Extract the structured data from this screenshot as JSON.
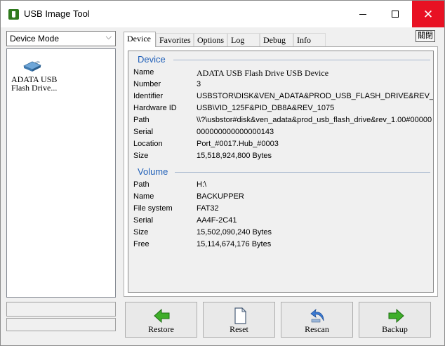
{
  "window": {
    "title": "USB Image Tool",
    "close_color": "#e81123"
  },
  "sidebar": {
    "mode": "Device Mode",
    "devices": [
      {
        "label": "ADATA USB Flash Drive..."
      }
    ]
  },
  "tabs": [
    {
      "label": "Device",
      "active": true
    },
    {
      "label": "Favorites",
      "active": false
    },
    {
      "label": "Options",
      "active": false
    },
    {
      "label": "Log",
      "active": false
    },
    {
      "label": "Debug",
      "active": false
    },
    {
      "label": "Info",
      "active": false
    }
  ],
  "toggle_label": "關閉",
  "device": {
    "title": "Device",
    "rows": [
      {
        "key": "Name",
        "value": "ADATA USB Flash Drive USB Device"
      },
      {
        "key": "Number",
        "value": "3"
      },
      {
        "key": "Identifier",
        "value": "USBSTOR\\DISK&VEN_ADATA&PROD_USB_FLASH_DRIVE&REV_"
      },
      {
        "key": "Hardware ID",
        "value": "USB\\VID_125F&PID_DB8A&REV_1075"
      },
      {
        "key": "Path",
        "value": "\\\\?\\usbstor#disk&ven_adata&prod_usb_flash_drive&rev_1.00#00000"
      },
      {
        "key": "Serial",
        "value": "000000000000000143"
      },
      {
        "key": "Location",
        "value": "Port_#0017.Hub_#0003"
      },
      {
        "key": "Size",
        "value": "15,518,924,800 Bytes"
      }
    ]
  },
  "volume": {
    "title": "Volume",
    "rows": [
      {
        "key": "Path",
        "value": "H:\\"
      },
      {
        "key": "Name",
        "value": "BACKUPPER"
      },
      {
        "key": "File system",
        "value": "FAT32"
      },
      {
        "key": "Serial",
        "value": "AA4F-2C41"
      },
      {
        "key": "Size",
        "value": "15,502,090,240 Bytes"
      },
      {
        "key": "Free",
        "value": "15,114,674,176 Bytes"
      }
    ]
  },
  "actions": {
    "restore": "Restore",
    "reset": "Reset",
    "rescan": "Rescan",
    "backup": "Backup"
  },
  "colors": {
    "section_title": "#1f5fb8",
    "arrow_green": "#3fae2a",
    "rescan_blue": "#3b7bd4"
  }
}
